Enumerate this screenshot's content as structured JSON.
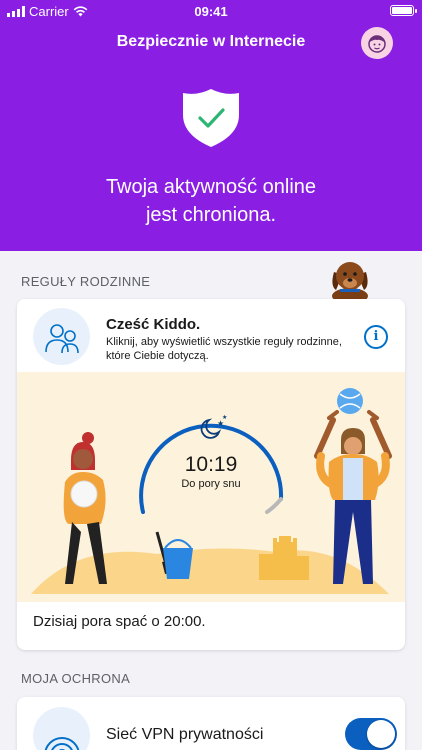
{
  "status_bar": {
    "carrier": "Carrier",
    "time": "09:41"
  },
  "header": {
    "title": "Bezpiecznie w Internecie",
    "status_message_line1": "Twoja aktywność online",
    "status_message_line2": "jest chroniona."
  },
  "family_rules": {
    "section_label": "REGUŁY RODZINNE",
    "greeting": "Cześć Kiddo.",
    "description": "Kliknij, aby wyświetlić wszystkie reguły rodzinne, które Ciebie dotyczą.",
    "info_label": "i",
    "clock_time": "10:19",
    "clock_label": "Do pory snu",
    "bedtime_text": "Dzisiaj pora spać o 20:00."
  },
  "protection": {
    "section_label": "MOJA OCHRONA",
    "vpn_label": "Sieć VPN prywatności",
    "vpn_enabled": true
  },
  "colors": {
    "brand_purple": "#8a1ee3",
    "accent_blue": "#0070c9",
    "toggle_on": "#0a5fbf",
    "scene_bg": "#fdf2dc"
  },
  "icons": [
    "signal-icon",
    "wifi-icon",
    "battery-icon",
    "avatar-icon",
    "shield-check-icon",
    "dog-icon",
    "family-icon",
    "info-icon",
    "moon-stars-icon",
    "vpn-icon"
  ]
}
